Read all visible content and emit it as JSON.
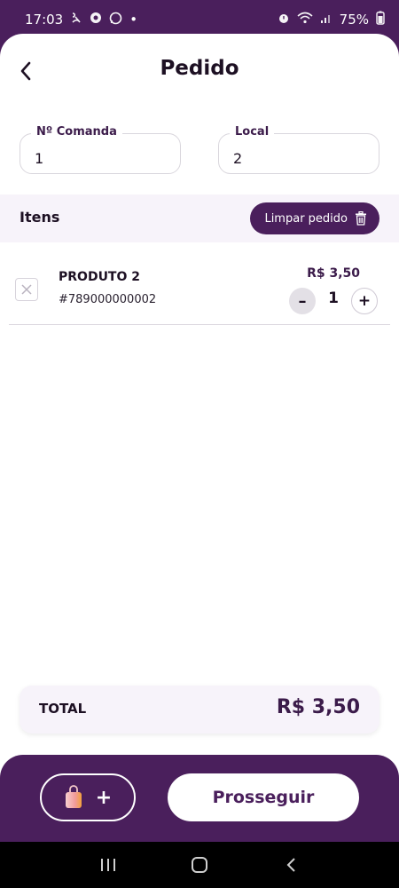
{
  "status_bar": {
    "time": "17:03",
    "battery": "75%",
    "dot": "•"
  },
  "header": {
    "title": "Pedido"
  },
  "fields": {
    "comanda": {
      "label": "Nº Comanda",
      "value": "1"
    },
    "local": {
      "label": "Local",
      "value": "2"
    }
  },
  "items_section": {
    "title": "Itens",
    "clear_label": "Limpar pedido"
  },
  "items": [
    {
      "name": "PRODUTO 2",
      "code": "#789000000002",
      "price": "R$ 3,50",
      "quantity": "1"
    }
  ],
  "qty_controls": {
    "minus": "–",
    "plus": "+"
  },
  "total": {
    "label": "TOTAL",
    "value": "R$ 3,50"
  },
  "actions": {
    "add_cart_plus": "+",
    "proceed_label": "Prosseguir"
  },
  "colors": {
    "brand": "#4a1f5c",
    "light_bg": "#f7f3fa",
    "text": "#1d1023"
  }
}
